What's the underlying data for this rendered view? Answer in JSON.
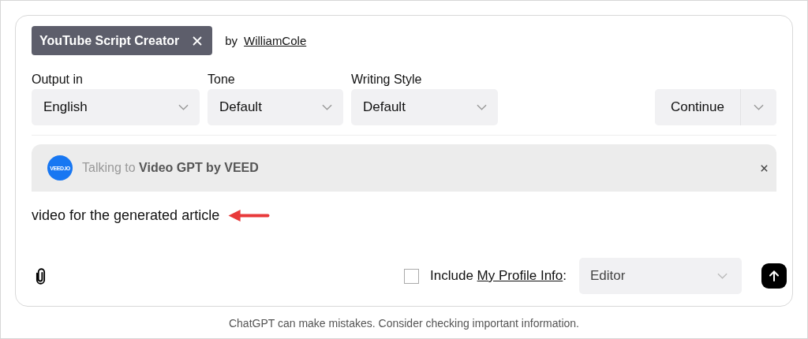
{
  "gpt_tag": {
    "title": "YouTube Script Creator",
    "by": "by",
    "author": "WilliamCole"
  },
  "selects": [
    {
      "label": "Output in",
      "value": "English"
    },
    {
      "label": "Tone",
      "value": "Default"
    },
    {
      "label": "Writing Style",
      "value": "Default"
    }
  ],
  "continue_button": "Continue",
  "mention": {
    "logo_text": "VEED.IO",
    "prefix": "Talking to",
    "name": "Video GPT by VEED"
  },
  "message": "video for the generated article",
  "profile": {
    "checked": false,
    "prefix": "Include ",
    "link": "My Profile Info",
    "suffix": ":",
    "role": "Editor"
  },
  "footer": "ChatGPT can make mistakes. Consider checking important information."
}
